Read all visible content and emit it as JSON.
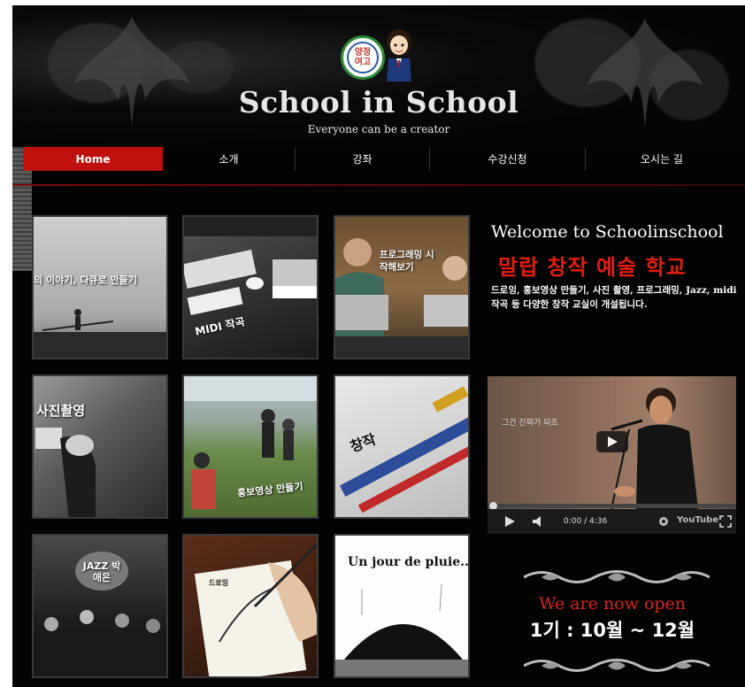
{
  "header": {
    "badge_line1": "양정",
    "badge_line2": "여고",
    "site_title": "School in School",
    "tagline": "Everyone can be a creator"
  },
  "nav": {
    "items": [
      {
        "label": "Home",
        "active": true
      },
      {
        "label": "소개",
        "active": false
      },
      {
        "label": "강좌",
        "active": false
      },
      {
        "label": "수강신청",
        "active": false
      },
      {
        "label": "오시는 길",
        "active": false
      }
    ]
  },
  "tiles": [
    {
      "label": "의 이야기, 다큐로 만들기",
      "icon": "documentary-photo"
    },
    {
      "label": "MIDI 작곡",
      "icon": "midi-keyboard-photo"
    },
    {
      "label": "프로그래밍 시작해보기",
      "icon": "laptop-students-photo"
    },
    {
      "label": "사진촬영",
      "icon": "camera-photo"
    },
    {
      "label": "홍보영상 만들기",
      "icon": "film-crew-photo"
    },
    {
      "label": "창작",
      "icon": "pens-photo"
    },
    {
      "label": "JAZZ 박애은",
      "icon": "jazz-band-photo"
    },
    {
      "label": "드로잉",
      "icon": "drawing-hand-photo"
    },
    {
      "label": "Un jour de pluie...",
      "icon": "umbrella-illustration"
    }
  ],
  "intro": {
    "welcome": "Welcome to Schoolinschool",
    "headline": "말랍 창작 예술 학교",
    "description": "드로잉, 홍보영상 만들기, 사진 촬영, 프로그래밍, Jazz, midi작곡 등 다양한 창작 교실이 개설됩니다."
  },
  "video": {
    "caption": "그건 진짜가 되죠",
    "time": "0:00 / 4:36",
    "brand": "YouTube",
    "progress": 0
  },
  "open": {
    "title": "We are now open",
    "dates": "1기 : 10월 ~ 12월"
  },
  "colors": {
    "accent_red": "#c0110f",
    "background": "#030303",
    "headline_red": "#e21c10"
  }
}
